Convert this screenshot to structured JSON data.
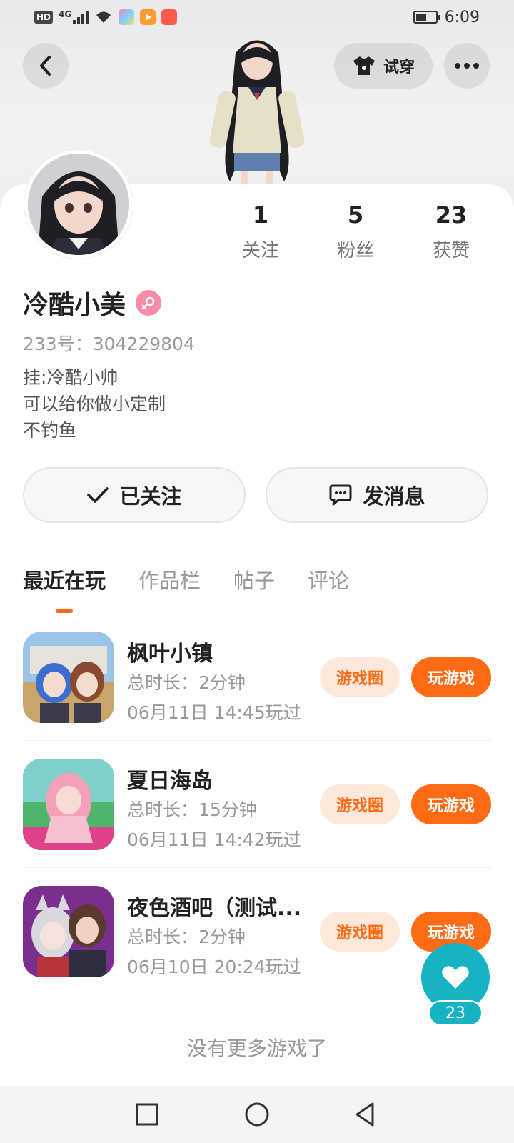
{
  "status_bar": {
    "left_chip": "HD",
    "network": "4G",
    "time": "6:09",
    "icons": [
      "hd-icon",
      "signal-icon",
      "wifi-icon",
      "app-icon-1",
      "app-icon-2",
      "app-icon-3",
      "battery-icon"
    ]
  },
  "header": {
    "back_icon": "chevron-left-icon",
    "try_on_label": "试穿",
    "more_icon": "more-dots-icon"
  },
  "profile": {
    "name": "冷酷小美",
    "gender_icon": "female-icon",
    "uid": "233号：304229804",
    "bio": [
      "挂:冷酷小帅",
      "可以给你做小定制",
      "不钓鱼"
    ],
    "stats": [
      {
        "value": "1",
        "label": "关注"
      },
      {
        "value": "5",
        "label": "粉丝"
      },
      {
        "value": "23",
        "label": "获赞"
      }
    ]
  },
  "actions": {
    "follow_label": "已关注",
    "message_label": "发消息"
  },
  "tabs": [
    {
      "label": "最近在玩",
      "active": true
    },
    {
      "label": "作品栏",
      "active": false
    },
    {
      "label": "帖子",
      "active": false
    },
    {
      "label": "评论",
      "active": false
    }
  ],
  "games": [
    {
      "title": "枫叶小镇",
      "duration": "总时长：2分钟",
      "last_played": "06月11日 14:45玩过",
      "circle_label": "游戏圈",
      "play_label": "玩游戏"
    },
    {
      "title": "夏日海岛",
      "duration": "总时长：15分钟",
      "last_played": "06月11日 14:42玩过",
      "circle_label": "游戏圈",
      "play_label": "玩游戏"
    },
    {
      "title": "夜色酒吧（测试...",
      "duration": "总时长：2分钟",
      "last_played": "06月10日 20:24玩过",
      "circle_label": "游戏圈",
      "play_label": "玩游戏"
    }
  ],
  "like_fab": {
    "count": "23",
    "icon": "heart-icon"
  },
  "footer_text": "没有更多游戏了",
  "nav": [
    "recent-apps-icon",
    "home-icon",
    "back-icon"
  ],
  "colors": {
    "accent": "#ff6a14",
    "accent_light": "#fee8dc",
    "like": "#17b3c4",
    "gender": "#f98ba8"
  }
}
